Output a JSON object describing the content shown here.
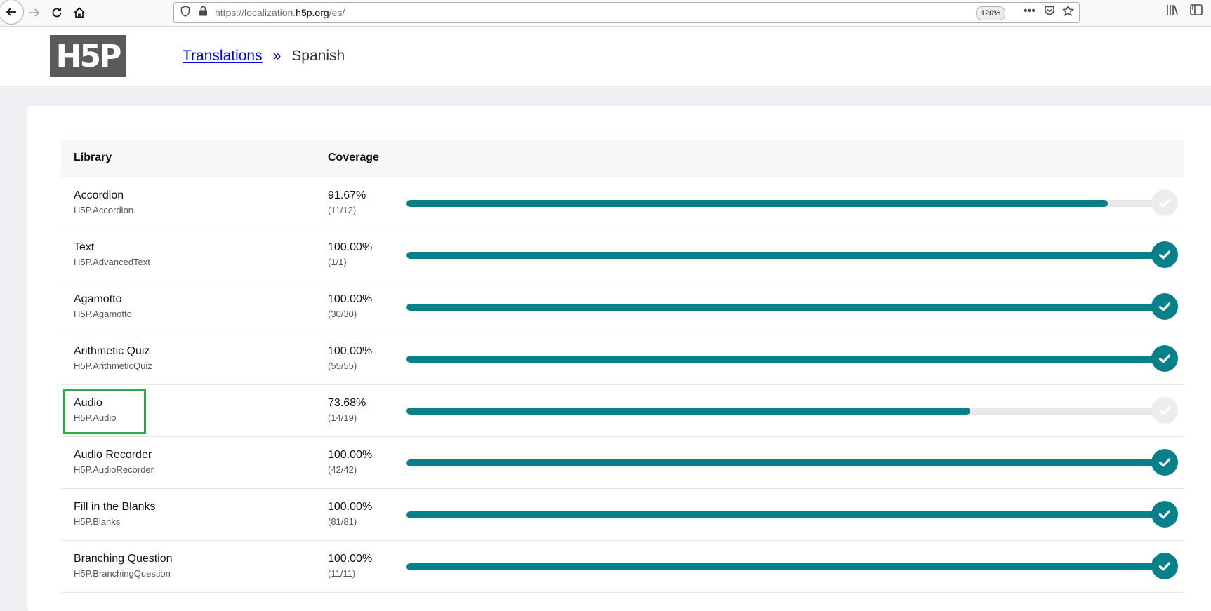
{
  "browser": {
    "url_prefix": "https://localization.",
    "url_domain": "h5p.org",
    "url_suffix": "/es/",
    "zoom": "120%"
  },
  "header": {
    "logo_text": "H5P",
    "breadcrumb_link": "Translations",
    "breadcrumb_sep": "»",
    "breadcrumb_current": "Spanish"
  },
  "table": {
    "col_library": "Library",
    "col_coverage": "Coverage",
    "rows": [
      {
        "name": "Accordion",
        "machine": "H5P.Accordion",
        "pct": "91.67%",
        "count": "(11/12)",
        "fraction": 0.9167
      },
      {
        "name": "Text",
        "machine": "H5P.AdvancedText",
        "pct": "100.00%",
        "count": "(1/1)",
        "fraction": 1
      },
      {
        "name": "Agamotto",
        "machine": "H5P.Agamotto",
        "pct": "100.00%",
        "count": "(30/30)",
        "fraction": 1
      },
      {
        "name": "Arithmetic Quiz",
        "machine": "H5P.ArithmeticQuiz",
        "pct": "100.00%",
        "count": "(55/55)",
        "fraction": 1
      },
      {
        "name": "Audio",
        "machine": "H5P.Audio",
        "pct": "73.68%",
        "count": "(14/19)",
        "fraction": 0.7368
      },
      {
        "name": "Audio Recorder",
        "machine": "H5P.AudioRecorder",
        "pct": "100.00%",
        "count": "(42/42)",
        "fraction": 1
      },
      {
        "name": "Fill in the Blanks",
        "machine": "H5P.Blanks",
        "pct": "100.00%",
        "count": "(81/81)",
        "fraction": 1
      },
      {
        "name": "Branching Question",
        "machine": "H5P.BranchingQuestion",
        "pct": "100.00%",
        "count": "(11/11)",
        "fraction": 1
      }
    ]
  },
  "colors": {
    "accent": "#07808a",
    "highlight": "#2bab3f"
  }
}
